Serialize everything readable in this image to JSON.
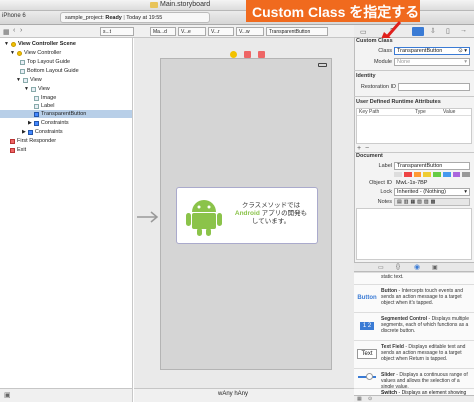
{
  "window": {
    "title": "Main.storyboard",
    "scheme_device": "iPhone 6"
  },
  "toolbar": {
    "status_project": "sample_project:",
    "status_state": "Ready",
    "status_time": "Today at 19:55"
  },
  "jumpbar": {
    "crumbs": [
      "s...t",
      "Ma...d",
      "V...e",
      "V...r",
      "V...w",
      "TransparentButton"
    ]
  },
  "outline": {
    "items": [
      {
        "label": "View Controller Scene"
      },
      {
        "label": "View Controller"
      },
      {
        "label": "Top Layout Guide"
      },
      {
        "label": "Bottom Layout Guide"
      },
      {
        "label": "View"
      },
      {
        "label": "View"
      },
      {
        "label": "Image"
      },
      {
        "label": "Label"
      },
      {
        "label": "TransparentButton"
      },
      {
        "label": "Constraints"
      },
      {
        "label": "Constraints"
      },
      {
        "label": "First Responder"
      },
      {
        "label": "Exit"
      }
    ]
  },
  "card": {
    "line1": "クラスメソッドでは",
    "line2a": "Android",
    "line2b": " アプリの開発も",
    "line3": "しています。"
  },
  "bottombar": {
    "size_class": "wAny  hAny"
  },
  "callout": {
    "text": "Custom Class を指定する"
  },
  "inspector": {
    "custom_class": {
      "section": "Custom Class",
      "class_label": "Class",
      "class_value": "TransparentButton",
      "module_label": "Module",
      "module_value": "None"
    },
    "identity": {
      "section": "Identity",
      "restoration_label": "Restoration ID"
    },
    "runtime": {
      "section": "User Defined Runtime Attributes",
      "col_key": "Key Path",
      "col_type": "Type",
      "col_value": "Value",
      "add": "+",
      "remove": "−"
    },
    "document": {
      "section": "Document",
      "label_label": "Label",
      "label_value": "TransparentButton",
      "objectid_label": "Object ID",
      "objectid_value": "MwL-1s-7BP",
      "lock_label": "Lock",
      "lock_value": "Inherited - (Nothing)",
      "notes_label": "Notes"
    },
    "library": [
      {
        "icon": "",
        "title": "",
        "desc": "static text."
      },
      {
        "icon": "Button",
        "title": "Button",
        "desc": " - Intercepts touch events and sends an action message to a target object when it's tapped."
      },
      {
        "icon": "1 2",
        "title": "Segmented Control",
        "desc": " - Displays multiple segments, each of which functions as a discrete button."
      },
      {
        "icon": "Text",
        "title": "Text Field",
        "desc": " - Displays editable text and sends an action message to a target object when Return is tapped."
      },
      {
        "icon": "",
        "title": "Slider",
        "desc": " - Displays a continuous range of values and allows the selection of a single value."
      },
      {
        "icon": "",
        "title": "Switch",
        "desc": " - Displays an element showing the boolean state of a value."
      }
    ]
  },
  "colors": {
    "callout": "#f06a1e",
    "selection": "#b8cfe8",
    "android": "#8bc34a"
  }
}
